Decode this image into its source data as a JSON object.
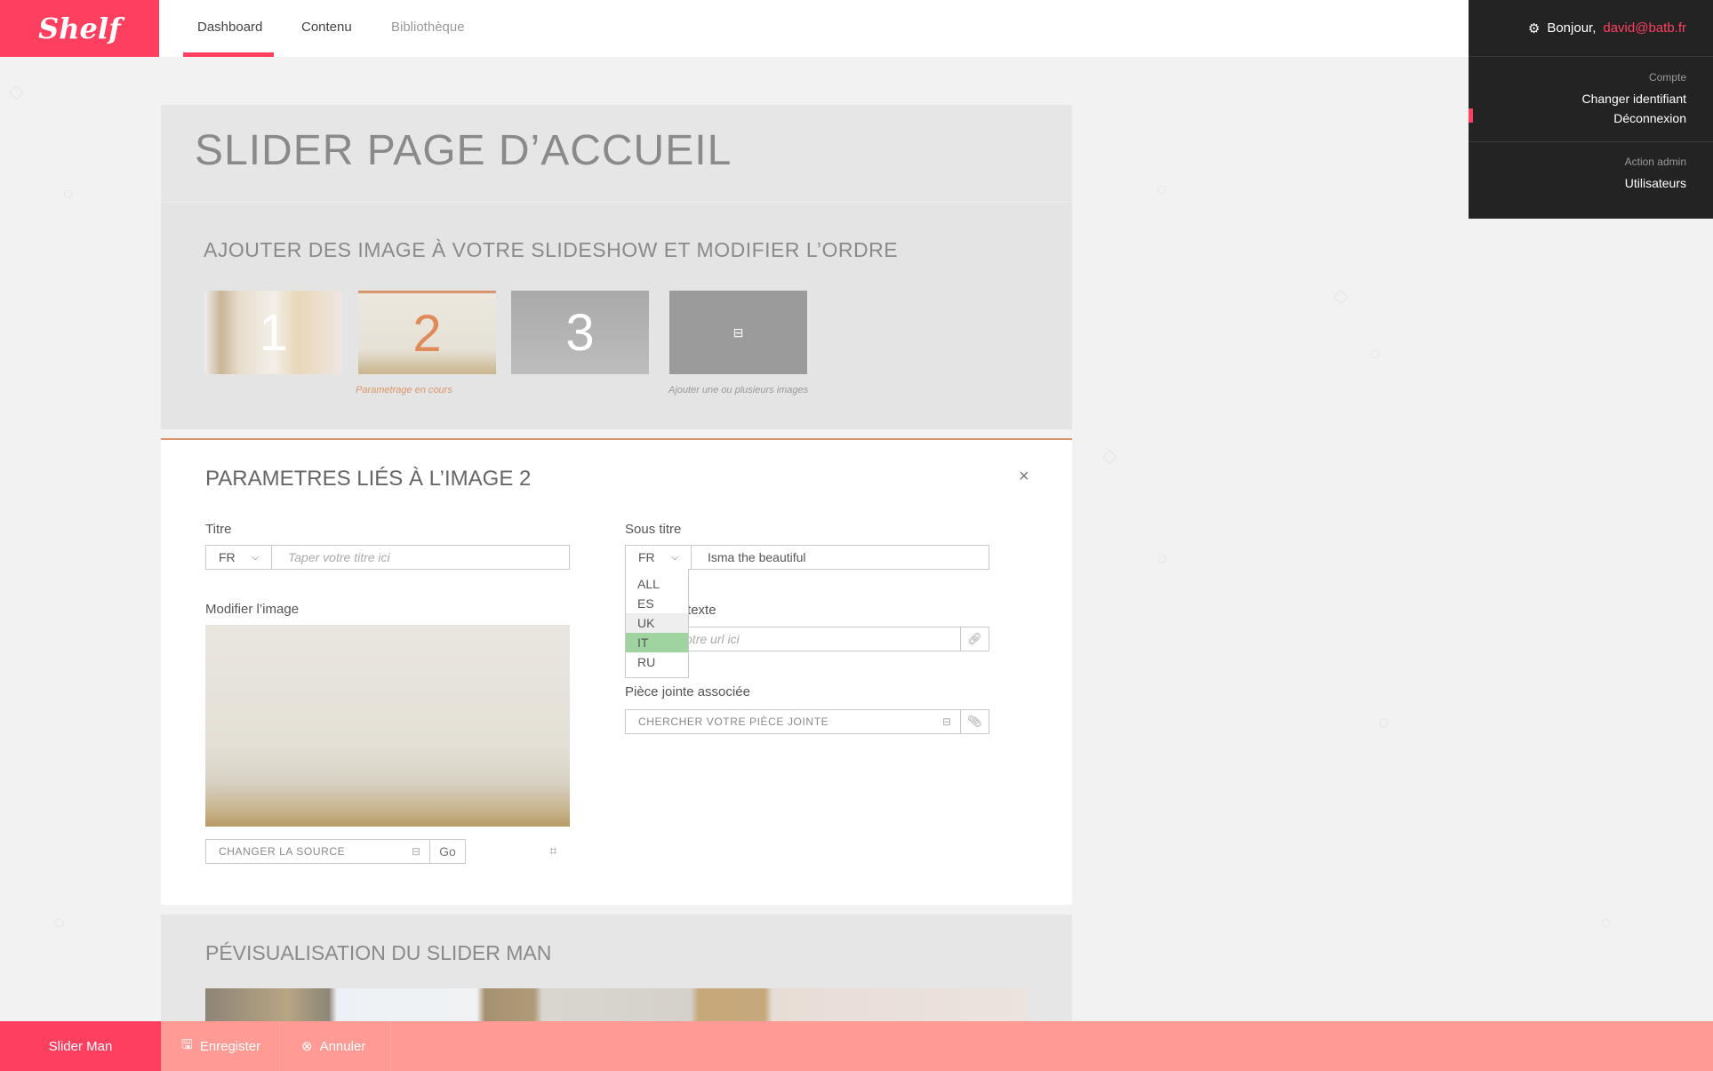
{
  "header": {
    "logo": "Shelf",
    "nav": [
      {
        "label": "Dashboard",
        "active": true
      },
      {
        "label": "Contenu"
      },
      {
        "label": "Bibliothèque"
      }
    ],
    "accent": "#ff3f5f"
  },
  "user": {
    "greeting": "Bonjour,",
    "email": "david@batb.fr",
    "groups": [
      {
        "label": "Compte",
        "links": [
          "Changer identifiant",
          "Déconnexion"
        ]
      },
      {
        "label": "Action admin",
        "links": [
          "Utilisateurs"
        ]
      }
    ]
  },
  "page": {
    "title": "SLIDER PAGE D’ACCUEIL"
  },
  "slideshow": {
    "heading": "AJOUTER DES IMAGE À VOTRE SLIDESHOW ET MODIFIER L’ORDRE",
    "thumbs": [
      "1",
      "2",
      "3"
    ],
    "active_caption": "Parametrage en cours",
    "add_caption": "Ajouter une ou plusieurs images"
  },
  "params": {
    "heading": "PARAMETRES LIÉS À L’IMAGE 2",
    "close": "×",
    "titre": {
      "label": "Titre",
      "lang": "FR",
      "placeholder": "Taper votre titre ici"
    },
    "sous_titre": {
      "label": "Sous titre",
      "lang": "FR",
      "value": "Isma the beautiful",
      "options": [
        "ALL",
        "ES",
        "UK",
        "IT",
        "RU"
      ],
      "hovered": "UK",
      "highlighted": "IT"
    },
    "lien": {
      "label": "Lien hypertexte",
      "placeholder": "Entrer votre url ici"
    },
    "piece": {
      "label": "Pièce jointe associée",
      "placeholder": "CHERCHER VOTRE PIÈCE JOINTE"
    },
    "image": {
      "label": "Modifier l’image",
      "source_placeholder": "CHANGER LA SOURCE",
      "go": "Go"
    }
  },
  "preview": {
    "heading": "PÉVISUALISATION DU SLIDER MAN"
  },
  "footer": {
    "section": "Slider Man",
    "save": "Enregister",
    "cancel": "Annuler"
  }
}
